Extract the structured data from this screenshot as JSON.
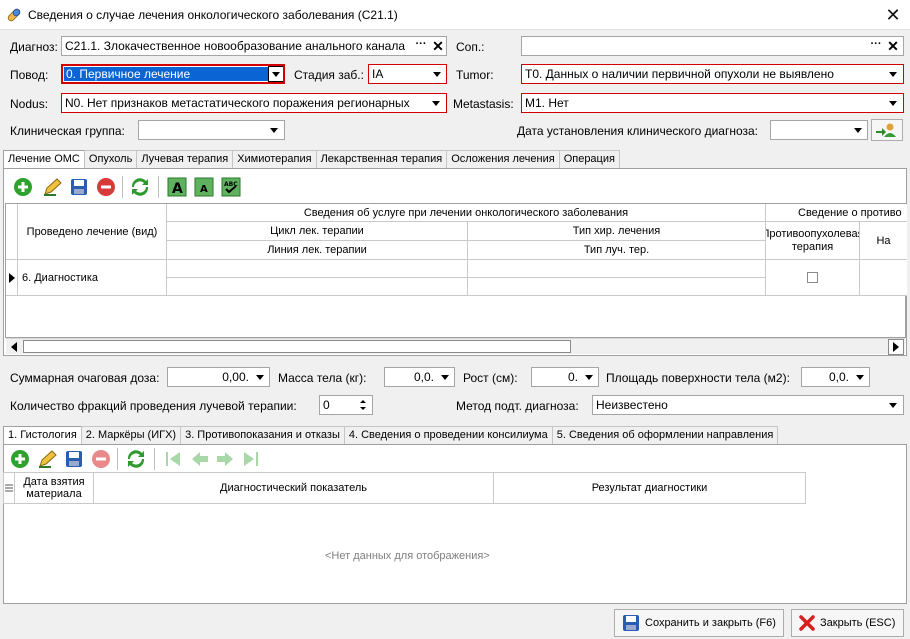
{
  "window": {
    "title": "Сведения о случае лечения онкологического заболевания (С21.1)"
  },
  "form": {
    "diagnosis_label": "Диагноз:",
    "diagnosis_value": "С21.1. Злокачественное новообразование анального канала",
    "sop_label": "Соп.:",
    "sop_value": "",
    "povod_label": "Повод:",
    "povod_value": "0. Первичное лечение",
    "stage_label": "Стадия заб.:",
    "stage_value": "IA",
    "tumor_label": "Tumor:",
    "tumor_value": "T0. Данных о наличии первичной опухоли не выявлено",
    "nodus_label": "Nodus:",
    "nodus_value": "N0. Нет признаков метастатического поражения регионарных",
    "metastasis_label": "Metastasis:",
    "metastasis_value": "M1. Нет",
    "clinical_group_label": "Клиническая группа:",
    "clinical_group_value": "",
    "clinical_date_label": "Дата установления клинического диагноза:",
    "clinical_date_value": ""
  },
  "top_tabs": [
    "Лечение ОМС",
    "Опухоль",
    "Лучевая терапия",
    "Химиотерапия",
    "Лекарственная терапия",
    "Осложения лечения",
    "Операция"
  ],
  "treatment_grid": {
    "col_treatment": "Проведено лечение (вид)",
    "group_service": "Сведения об услуге при лечении онкологического заболевания",
    "col_cycle": "Цикл лек. терапии",
    "col_line": "Линия лек. терапии",
    "col_surgery_type": "Тип хир. лечения",
    "col_radiation_type": "Тип луч. тер.",
    "group_contra": "Сведение о противо",
    "col_antitumor": "Противоопухолевая терапия",
    "col_next": "На",
    "row_value": "6. Диагностика"
  },
  "measures": {
    "dose_label": "Суммарная очаговая доза:",
    "dose_value": "0,00.",
    "mass_label": "Масса тела (кг):",
    "mass_value": "0,0.",
    "height_label": "Рост (см):",
    "height_value": "0.",
    "area_label": "Площадь поверхности тела (м2):",
    "area_value": "0,0.",
    "fractions_label": "Количество фракций проведения лучевой терапии:",
    "fractions_value": "0",
    "method_label": "Метод подт. диагноза:",
    "method_value": "Неизвестено"
  },
  "bottom_tabs": [
    "1. Гистология",
    "2. Маркёры (ИГХ)",
    "3. Противопоказания и отказы",
    "4. Сведения о проведении консилиума",
    "5. Сведения об оформлении направления"
  ],
  "histology_grid": {
    "col_date": "Дата взятия материала",
    "col_indicator": "Диагностический показатель",
    "col_result": "Результат диагностики",
    "empty_text": "<Нет данных для отображения>"
  },
  "footer": {
    "save_label": "Сохранить и закрыть (F6)",
    "close_label": "Закрыть (ESC)"
  }
}
